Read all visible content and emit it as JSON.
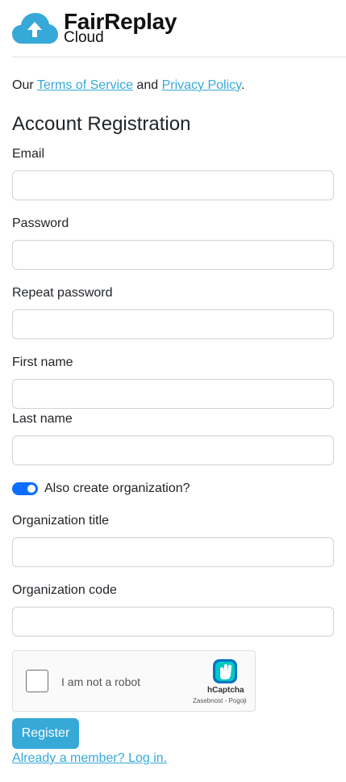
{
  "brand": {
    "name": "FairReplay",
    "sub": "Cloud"
  },
  "terms": {
    "prefix": "Our ",
    "tos_link": "Terms of Service",
    "and": " and ",
    "privacy_link": "Privacy Policy",
    "suffix": "."
  },
  "page_title": "Account Registration",
  "form": {
    "email_label": "Email",
    "password_label": "Password",
    "repeat_password_label": "Repeat password",
    "first_name_label": "First name",
    "last_name_label": "Last name",
    "org_toggle_label": "Also create organization?",
    "org_toggle_on": true,
    "org_title_label": "Organization title",
    "org_code_label": "Organization code"
  },
  "captcha": {
    "text": "I am not a robot",
    "brand": "hCaptcha",
    "links": "Zasebnost - Pogoji"
  },
  "register_button": "Register",
  "login_link": "Already a member? Log in.",
  "colors": {
    "accent": "#36a9d9",
    "toggle": "#0d6efd",
    "border": "#ced4da"
  }
}
